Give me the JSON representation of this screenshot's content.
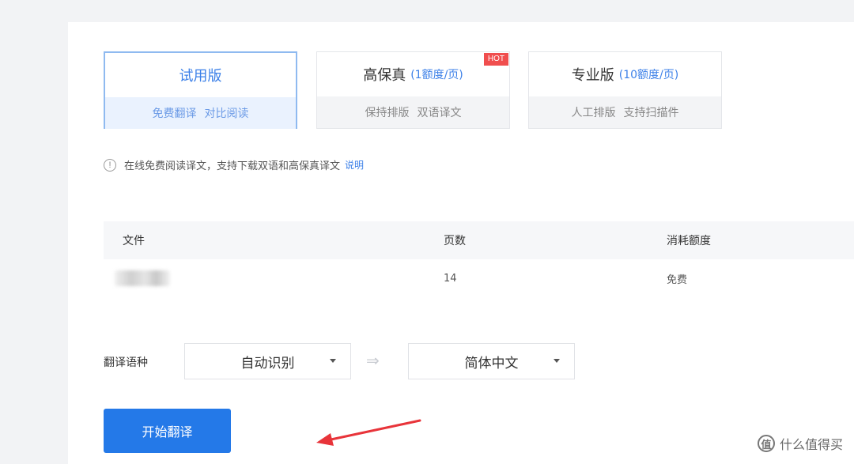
{
  "plans": [
    {
      "name": "试用版",
      "price": "",
      "features": [
        "免费翻译",
        "对比阅读"
      ],
      "badge": "",
      "selected": true
    },
    {
      "name": "高保真",
      "price": "(1额度/页)",
      "features": [
        "保持排版",
        "双语译文"
      ],
      "badge": "HOT",
      "selected": false
    },
    {
      "name": "专业版",
      "price": "(10额度/页)",
      "features": [
        "人工排版",
        "支持扫描件"
      ],
      "badge": "",
      "selected": false
    }
  ],
  "info": {
    "icon": "info-circle-icon",
    "text": "在线免费阅读译文，支持下载双语和高保真译文",
    "link": "说明"
  },
  "table": {
    "headers": [
      "文件",
      "页数",
      "消耗额度"
    ],
    "rows": [
      {
        "file": "",
        "pages": "14",
        "cost": "免费"
      }
    ]
  },
  "language": {
    "label": "翻译语种",
    "source": "自动识别",
    "target": "简体中文",
    "arrow": "⇒"
  },
  "start_button": "开始翻译",
  "colors": {
    "accent": "#2479e8",
    "hot_badge": "#f04e4e",
    "annotation_arrow": "#e8343a"
  },
  "watermark": {
    "logo": "值",
    "text": "什么值得买"
  }
}
